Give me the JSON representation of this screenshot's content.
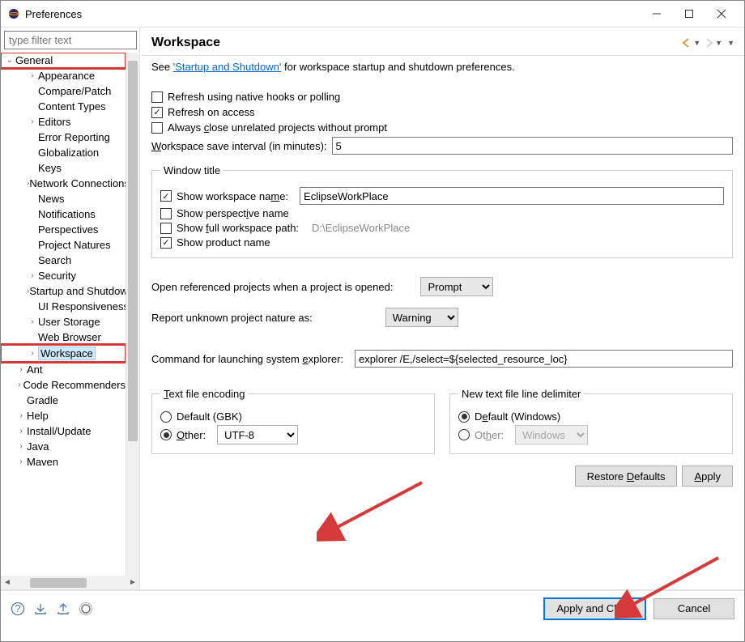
{
  "window": {
    "title": "Preferences"
  },
  "filter": {
    "placeholder": "type filter text"
  },
  "tree": {
    "general": "General",
    "items": [
      "Appearance",
      "Compare/Patch",
      "Content Types",
      "Editors",
      "Error Reporting",
      "Globalization",
      "Keys",
      "Network Connections",
      "News",
      "Notifications",
      "Perspectives",
      "Project Natures",
      "Search",
      "Security",
      "Startup and Shutdown",
      "UI Responsiveness",
      "User Storage",
      "Web Browser",
      "Workspace"
    ],
    "root": [
      "Ant",
      "Code Recommenders",
      "Gradle",
      "Help",
      "Install/Update",
      "Java",
      "Maven"
    ]
  },
  "page": {
    "title": "Workspace",
    "intro_pre": "See ",
    "intro_link": "'Startup and Shutdown'",
    "intro_post": " for workspace startup and shutdown preferences.",
    "chk_refresh_hooks": "Refresh using native hooks or polling",
    "chk_refresh_access": "Refresh on access",
    "chk_close_unrelated": "Always close unrelated projects without prompt",
    "save_interval_label": "Workspace save interval (in minutes):",
    "save_interval_value": "5",
    "window_title_legend": "Window title",
    "chk_ws_name": "Show workspace name:",
    "ws_name_value": "EclipseWorkPlace",
    "chk_perspective": "Show perspective name",
    "chk_full_path": "Show full workspace path:",
    "full_path_value": "D:\\EclipseWorkPlace",
    "chk_product": "Show product name",
    "open_ref_label": "Open referenced projects when a project is opened:",
    "open_ref_value": "Prompt",
    "unknown_nature_label": "Report unknown project nature as:",
    "unknown_nature_value": "Warning",
    "explorer_label": "Command for launching system explorer:",
    "explorer_value": "explorer /E,/select=${selected_resource_loc}",
    "encoding_legend": "Text file encoding",
    "encoding_default": "Default (GBK)",
    "encoding_other": "Other:",
    "encoding_value": "UTF-8",
    "delimiter_legend": "New text file line delimiter",
    "delimiter_default": "Default (Windows)",
    "delimiter_other": "Other:",
    "delimiter_value": "Windows",
    "btn_restore": "Restore Defaults",
    "btn_apply": "Apply",
    "btn_apply_close": "Apply and Close",
    "btn_cancel": "Cancel"
  }
}
